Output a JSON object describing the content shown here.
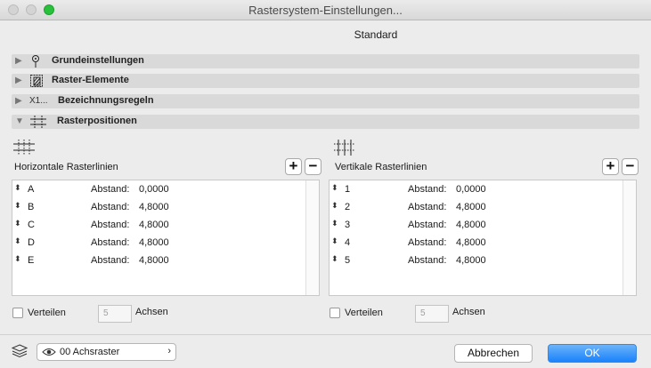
{
  "window": {
    "title": "Rastersystem-Einstellungen..."
  },
  "preset": "Standard",
  "sections": [
    {
      "label": "Grundeinstellungen",
      "expanded": false,
      "icon": "pin-icon"
    },
    {
      "label": "Raster-Elemente",
      "expanded": false,
      "icon": "hatch-frame-icon"
    },
    {
      "label": "Bezeichnungsregeln",
      "expanded": false,
      "icon": "x1-numbering-icon",
      "icon_text": "X1..."
    },
    {
      "label": "Rasterpositionen",
      "expanded": true,
      "icon": "grid-positions-icon"
    }
  ],
  "horizontal": {
    "title": "Horizontale Rasterlinien",
    "add": "+",
    "remove": "−",
    "rows": [
      {
        "name": "A",
        "label": "Abstand:",
        "value": "0,0000"
      },
      {
        "name": "B",
        "label": "Abstand:",
        "value": "4,8000"
      },
      {
        "name": "C",
        "label": "Abstand:",
        "value": "4,8000"
      },
      {
        "name": "D",
        "label": "Abstand:",
        "value": "4,8000"
      },
      {
        "name": "E",
        "label": "Abstand:",
        "value": "4,8000"
      }
    ],
    "distribute_label": "Verteilen",
    "axes_count": "5",
    "axes_label": "Achsen"
  },
  "vertical": {
    "title": "Vertikale Rasterlinien",
    "add": "+",
    "remove": "−",
    "rows": [
      {
        "name": "1",
        "label": "Abstand:",
        "value": "0,0000"
      },
      {
        "name": "2",
        "label": "Abstand:",
        "value": "4,8000"
      },
      {
        "name": "3",
        "label": "Abstand:",
        "value": "4,8000"
      },
      {
        "name": "4",
        "label": "Abstand:",
        "value": "4,8000"
      },
      {
        "name": "5",
        "label": "Abstand:",
        "value": "4,8000"
      }
    ],
    "distribute_label": "Verteilen",
    "axes_count": "5",
    "axes_label": "Achsen"
  },
  "footer": {
    "layer": "00 Achsraster",
    "cancel": "Abbrechen",
    "ok": "OK"
  },
  "colors": {
    "ok_button": "#1a82fb",
    "section_bar": "#d9d9d9",
    "zoom_button": "#29c13b"
  }
}
